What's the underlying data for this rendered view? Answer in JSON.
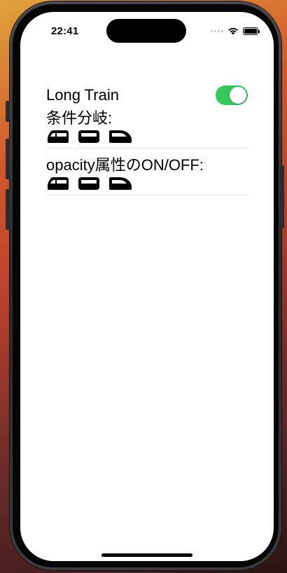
{
  "status_bar": {
    "time": "22:41",
    "icons": [
      "signal-dots-icon",
      "wifi-icon",
      "battery-icon"
    ]
  },
  "toggle_row": {
    "label": "Long Train",
    "is_on": true,
    "on_color": "#34c759"
  },
  "sections": [
    {
      "title": "条件分岐:",
      "cars": [
        "train-front-car-icon",
        "train-middle-car-icon",
        "train-head-car-icon"
      ]
    },
    {
      "title": "opacity属性のON/OFF:",
      "cars": [
        "train-front-car-icon",
        "train-middle-car-icon",
        "train-head-car-icon"
      ]
    }
  ]
}
